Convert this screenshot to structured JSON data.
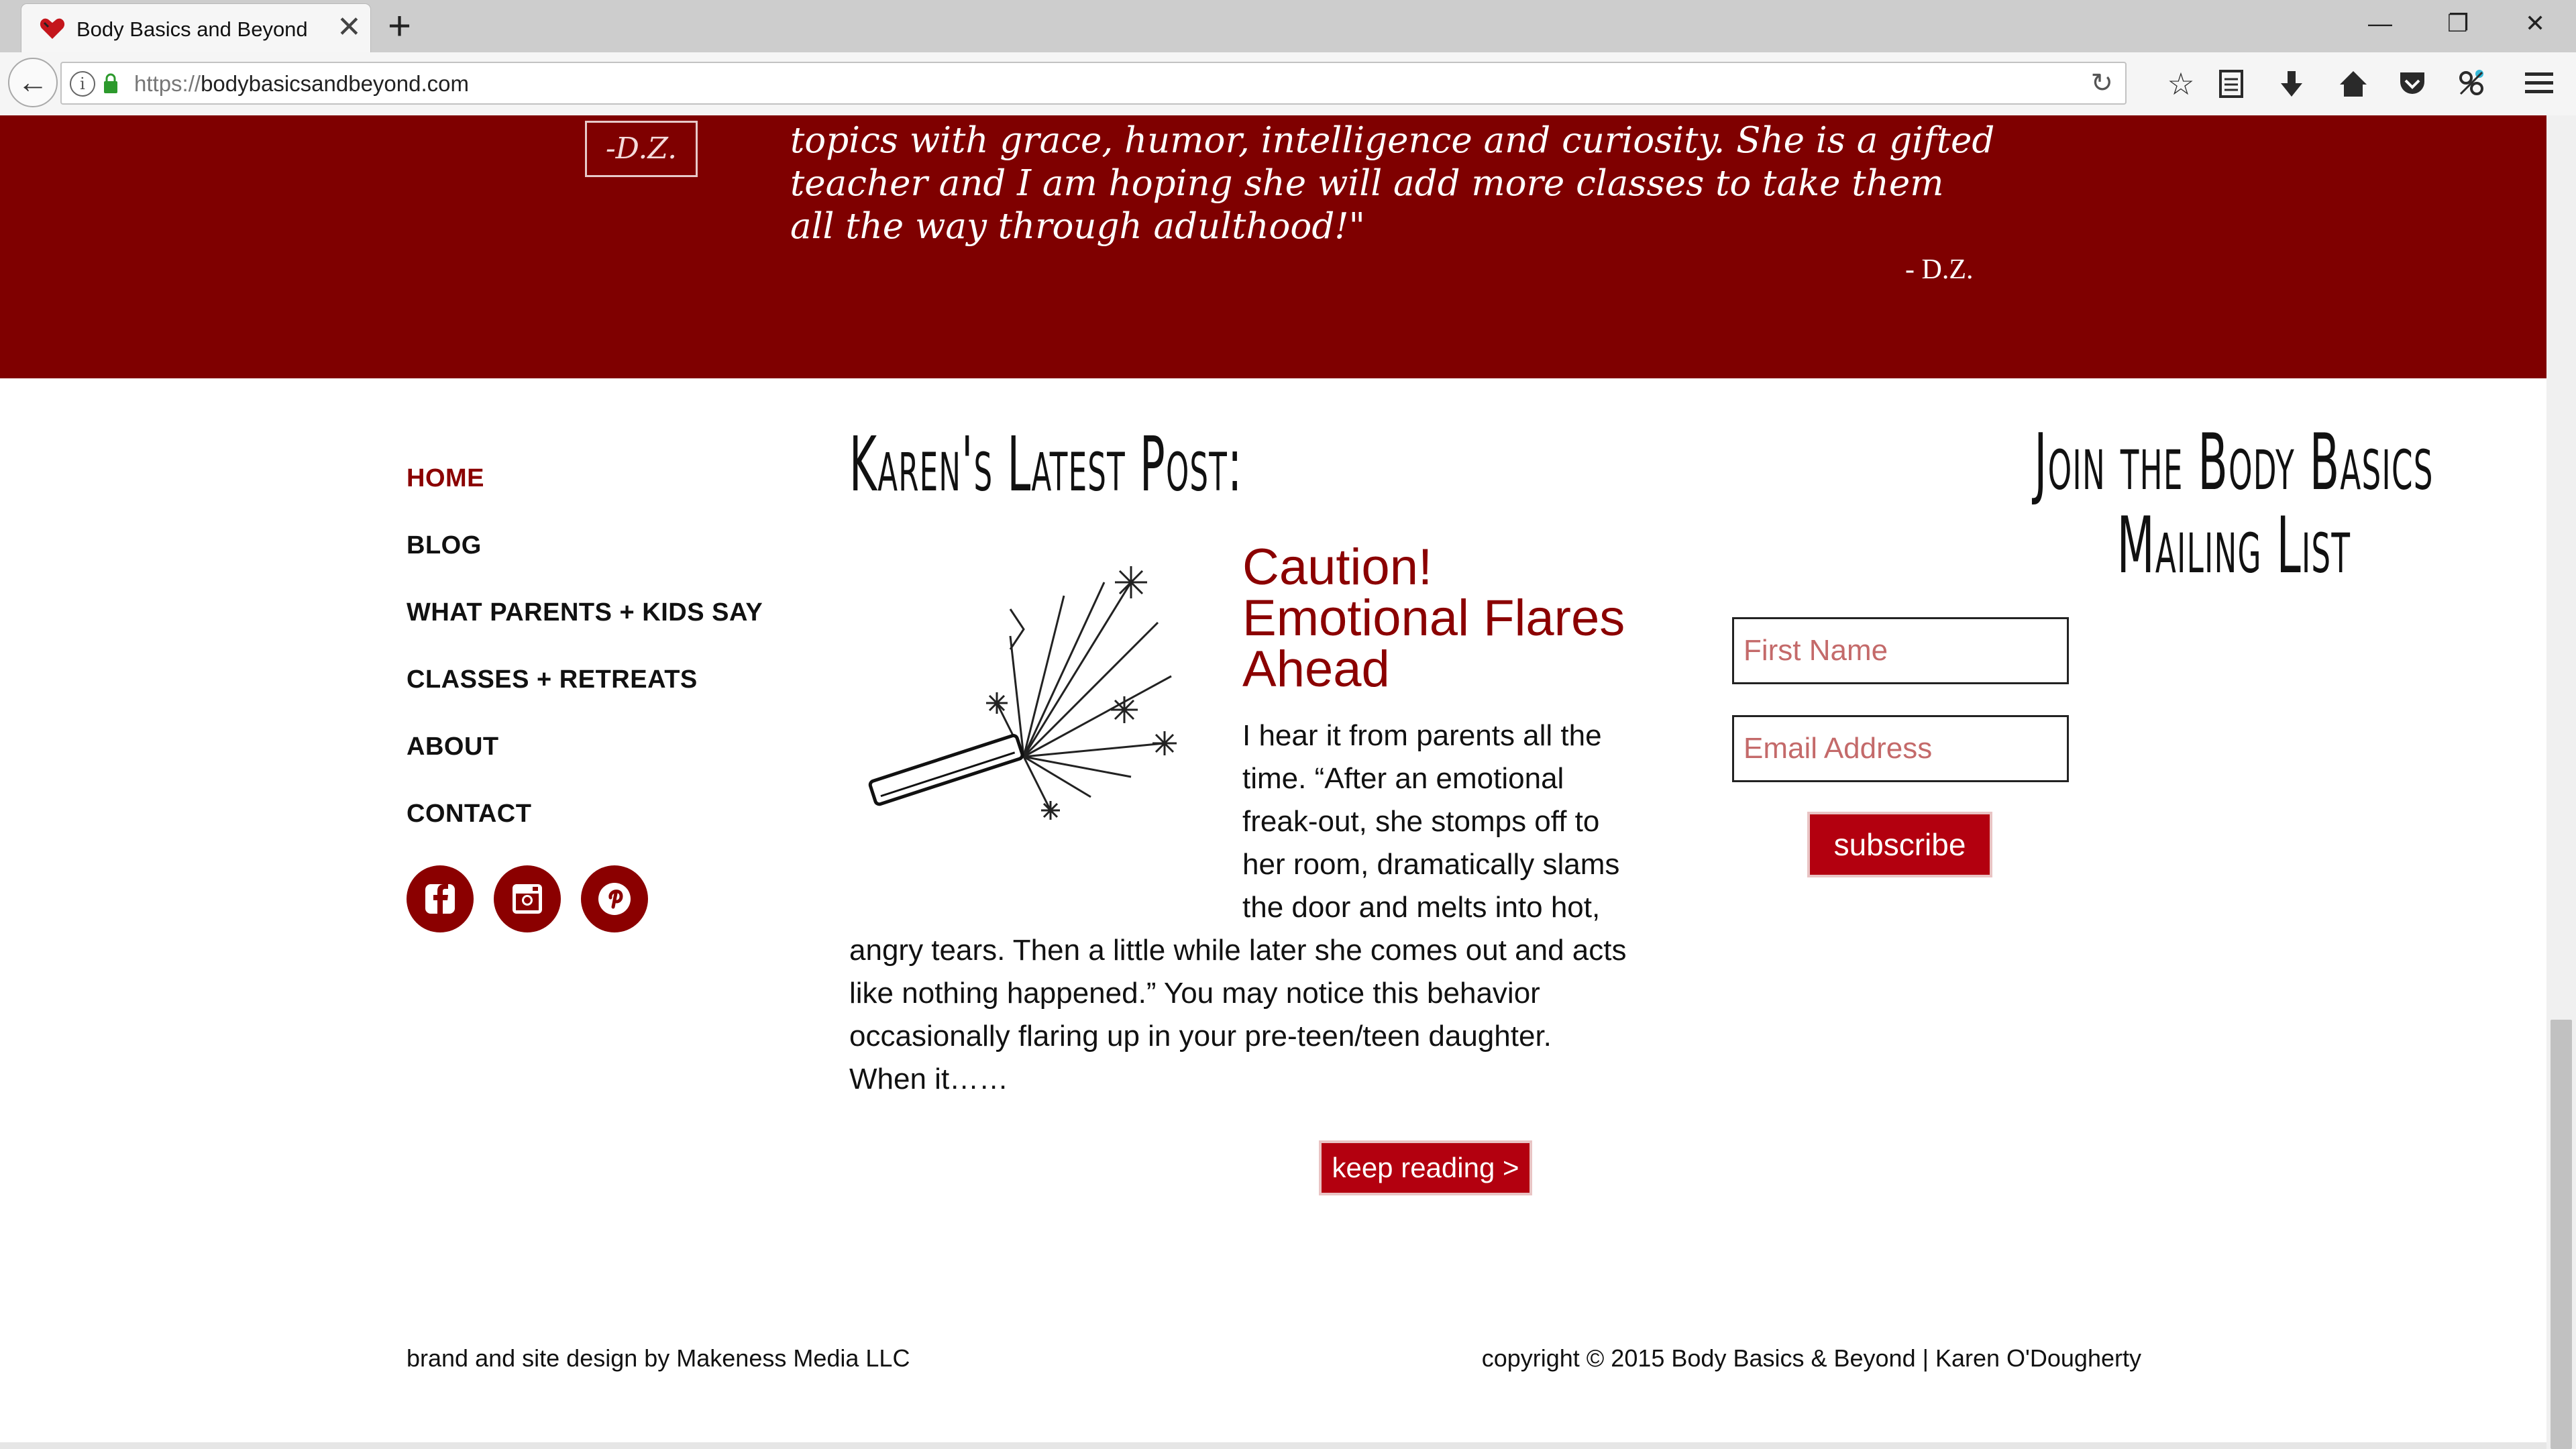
{
  "browser": {
    "tab_title": "Body Basics and Beyond",
    "new_tab": "+",
    "tab_close": "✕",
    "url_protocol": "https://",
    "url_host": "bodybasicsandbeyond.com",
    "window_minimize": "—",
    "window_restore": "❐",
    "window_close": "✕",
    "icons": [
      "back-icon",
      "info-icon",
      "lock-icon",
      "reload-icon",
      "bookmark-star-icon",
      "reading-list-icon",
      "download-icon",
      "home-icon",
      "pocket-icon",
      "extension-icon",
      "menu-icon"
    ]
  },
  "testimonial": {
    "logo_text": "-D.Z.",
    "quote": "topics with grace, humor, intelligence and curiosity. She is a gifted teacher and I am hoping she will add more classes to take them all the way through adulthood!\"",
    "author": "- D.Z."
  },
  "nav": {
    "items": [
      {
        "label": "HOME",
        "active": true
      },
      {
        "label": "BLOG"
      },
      {
        "label": "WHAT PARENTS + KIDS SAY"
      },
      {
        "label": "CLASSES + RETREATS"
      },
      {
        "label": "ABOUT"
      },
      {
        "label": "CONTACT"
      }
    ],
    "social": [
      "facebook-icon",
      "instagram-icon",
      "pinterest-icon"
    ]
  },
  "latest_post": {
    "heading": "Karen's Latest Post:",
    "title": "Caution! Emotional Flares Ahead",
    "excerpt": "I hear it from parents all the time. “After an emotional freak-out, she stomps off to her room, dramatically slams the door and melts into hot, angry tears. Then a little while later she comes out and acts like nothing happened.” You may notice this behavior occasionally flaring up in your pre-teen/teen daughter. When it……",
    "button": "keep reading >"
  },
  "mailing": {
    "heading_line1": "Join the Body Basics",
    "heading_line2": "Mailing List",
    "first_name_placeholder": "First Name",
    "email_placeholder": "Email Address",
    "button": "subscribe"
  },
  "footer": {
    "left": "brand and site design by Makeness Media LLC",
    "right": "copyright © 2015 Body Basics & Beyond | Karen O'Dougherty"
  },
  "colors": {
    "brand_red": "#7f0000",
    "button_red": "#b3000f"
  }
}
